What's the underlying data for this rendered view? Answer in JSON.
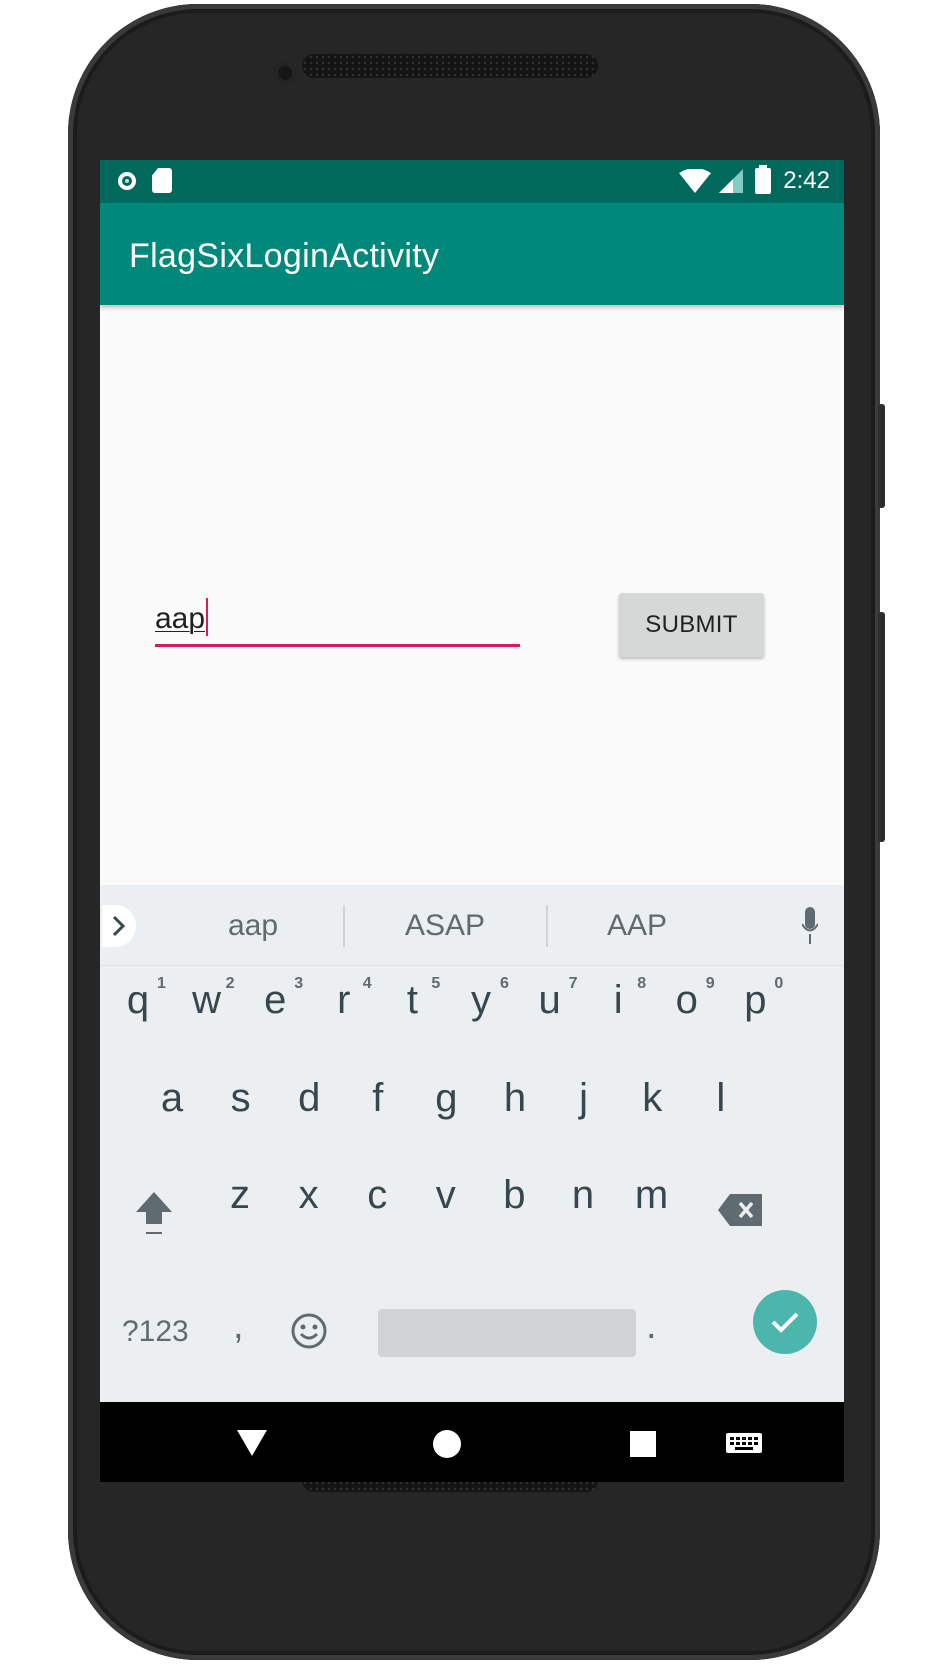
{
  "status_bar": {
    "time": "2:42"
  },
  "app_bar": {
    "title": "FlagSixLoginActivity"
  },
  "form": {
    "input_value": "aap",
    "submit_label": "SUBMIT"
  },
  "keyboard": {
    "suggestions": [
      "aap",
      "ASAP",
      "AAP"
    ],
    "row1": [
      "q",
      "w",
      "e",
      "r",
      "t",
      "y",
      "u",
      "i",
      "o",
      "p"
    ],
    "row1_hints": [
      "1",
      "2",
      "3",
      "4",
      "5",
      "6",
      "7",
      "8",
      "9",
      "0"
    ],
    "row2": [
      "a",
      "s",
      "d",
      "f",
      "g",
      "h",
      "j",
      "k",
      "l"
    ],
    "row3": [
      "z",
      "x",
      "c",
      "v",
      "b",
      "n",
      "m"
    ],
    "symbols_key": "?123",
    "comma_key": ",",
    "period_key": "."
  },
  "colors": {
    "status_bar": "#00695c",
    "app_bar": "#00897b",
    "accent": "#d81b60",
    "enter_key": "#4db6ac"
  }
}
